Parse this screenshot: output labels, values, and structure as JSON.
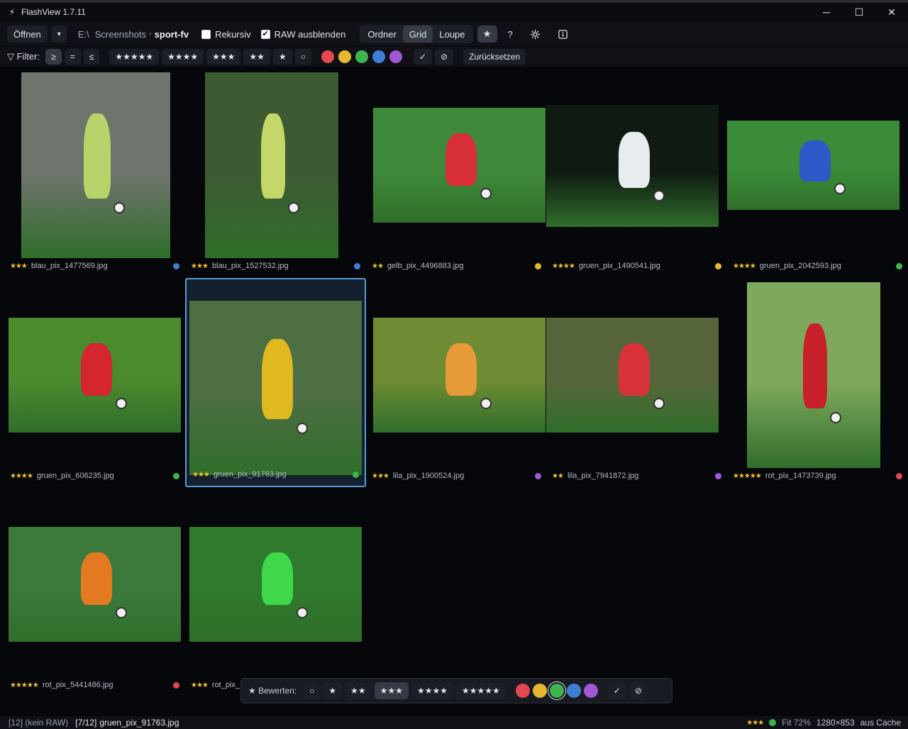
{
  "window": {
    "title": "FlashView 1.7.11",
    "controls": {
      "minimize": "─",
      "maximize": "☐",
      "close": "✕"
    }
  },
  "toolbar": {
    "open_label": "Öffnen",
    "open_dropdown": "▾",
    "breadcrumb": [
      "E:\\",
      "Screenshots",
      "sport-fv"
    ],
    "breadcrumb_sep": "›",
    "recursive_label": "Rekursiv",
    "recursive_checked": false,
    "raw_hide_label": "RAW ausblenden",
    "raw_hide_checked": true,
    "views": [
      "Ordner",
      "Grid",
      "Loupe"
    ],
    "active_view": "Grid",
    "star_label": "★",
    "help_label": "?",
    "settings_icon": "gear-icon",
    "info_icon": "info-icon"
  },
  "filter": {
    "label": "▽ Filter:",
    "comparators": [
      "≥",
      "=",
      "≤"
    ],
    "active_comparator": "≥",
    "ratings": [
      "★★★★★",
      "★★★★",
      "★★★",
      "★★",
      "★",
      "○"
    ],
    "colors": [
      "#e34850",
      "#e8b830",
      "#3fb34f",
      "#3e7fd6",
      "#a257d3"
    ],
    "picked_label": "✓",
    "rejected_label": "⊘",
    "reset_label": "Zurücksetzen"
  },
  "grid": {
    "items": [
      {
        "stars": "★★★",
        "name": "blau_pix_1477569.jpg",
        "color": "#3e7fd6",
        "thumb_bg": "#6f746d",
        "thumb_accent": "#b7d36a"
      },
      {
        "stars": "★★★",
        "name": "blau_pix_1527532.jpg",
        "color": "#3e7fd6",
        "thumb_bg": "#3d5a32",
        "thumb_accent": "#c4d86a"
      },
      {
        "stars": "★★",
        "name": "gelb_pix_4496883.jpg",
        "color": "#e8b830",
        "thumb_bg": "#3f8a3a",
        "thumb_accent": "#d8303a"
      },
      {
        "stars": "★★★★",
        "name": "gruen_pix_1490541.jpg",
        "color": "#e8b830",
        "thumb_bg": "#0e1a12",
        "thumb_accent": "#e9ecef"
      },
      {
        "stars": "★★★★",
        "name": "gruen_pix_2042593.jpg",
        "color": "#3fb34f",
        "thumb_bg": "#3a8c38",
        "thumb_accent": "#2c58c8"
      },
      {
        "stars": "★★★★",
        "name": "gruen_pix_606235.jpg",
        "color": "#3fb34f",
        "thumb_bg": "#4c8a2e",
        "thumb_accent": "#d3262f"
      },
      {
        "stars": "★★★",
        "name": "gruen_pix_91763.jpg",
        "color": "#3fb34f",
        "thumb_bg": "#4e6e44",
        "thumb_accent": "#e0b820"
      },
      {
        "stars": "★★★",
        "name": "lila_pix_1900524.jpg",
        "color": "#a257d3",
        "thumb_bg": "#6f8c34",
        "thumb_accent": "#e79a3a"
      },
      {
        "stars": "★★",
        "name": "lila_pix_7941872.jpg",
        "color": "#a257d3",
        "thumb_bg": "#57663a",
        "thumb_accent": "#d8323a"
      },
      {
        "stars": "★★★★★",
        "name": "rot_pix_1473739.jpg",
        "color": "#e34850",
        "thumb_bg": "#7fa85c",
        "thumb_accent": "#c8202a"
      },
      {
        "stars": "★★★★★",
        "name": "rot_pix_5441486.jpg",
        "color": "#e34850",
        "thumb_bg": "#3c7a3c",
        "thumb_accent": "#e37a22"
      },
      {
        "stars": "★★★",
        "name": "rot_pix_",
        "color": "#e34850",
        "thumb_bg": "#2f7a2c",
        "thumb_accent": "#3ed84a"
      }
    ]
  },
  "rating_bar": {
    "label": "★ Bewerten:",
    "ratings": [
      "○",
      "★",
      "★★",
      "★★★",
      "★★★★",
      "★★★★★"
    ],
    "active_rating": "★★★",
    "colors": [
      "#e34850",
      "#e8b830",
      "#3fb34f",
      "#3e7fd6",
      "#a257d3"
    ],
    "active_color": "#3fb34f",
    "picked_label": "✓",
    "rejected_label": "⊘"
  },
  "status": {
    "count": "[12] (kein RAW)",
    "position": "[7/12]",
    "filename": "gruen_pix_91763.jpg",
    "stars": "★★★",
    "color": "#3fb34f",
    "zoom": "Fit 72%",
    "dimensions": "1280×853",
    "source": "aus Cache"
  }
}
